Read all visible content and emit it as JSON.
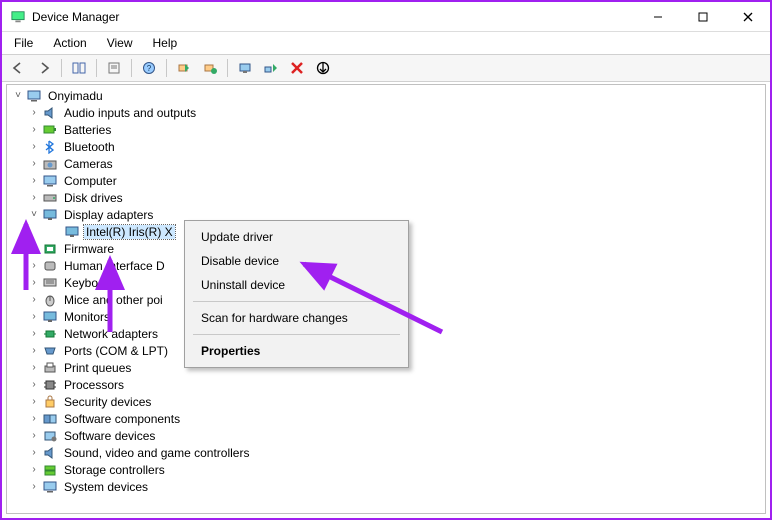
{
  "title": "Device Manager",
  "menubar": {
    "file": "File",
    "action": "Action",
    "view": "View",
    "help": "Help"
  },
  "root": "Onyimadu",
  "categories": [
    "Audio inputs and outputs",
    "Batteries",
    "Bluetooth",
    "Cameras",
    "Computer",
    "Disk drives",
    "Display adapters",
    "Firmware",
    "Human Interface D",
    "Keyboards",
    "Mice and other poi",
    "Monitors",
    "Network adapters",
    "Ports (COM & LPT)",
    "Print queues",
    "Processors",
    "Security devices",
    "Software components",
    "Software devices",
    "Sound, video and game controllers",
    "Storage controllers",
    "System devices"
  ],
  "display_child": "Intel(R) Iris(R) X",
  "context": {
    "update": "Update driver",
    "disable": "Disable device",
    "uninstall": "Uninstall device",
    "scan": "Scan for hardware changes",
    "properties": "Properties"
  }
}
